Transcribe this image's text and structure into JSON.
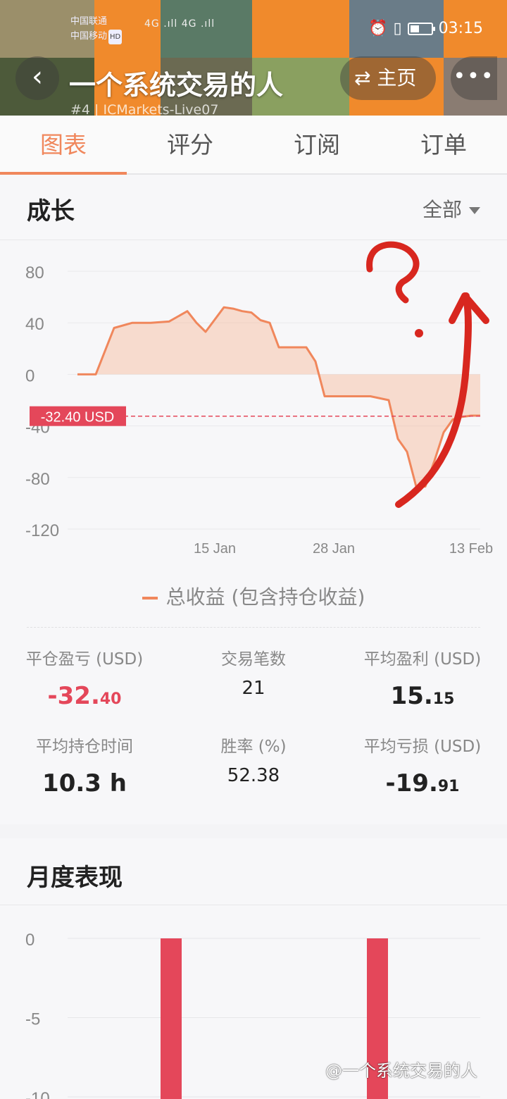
{
  "status_bar": {
    "carrier_1": "中国联通",
    "carrier_2": "中国移动",
    "hd_badge": "HD",
    "signal": "4G .ıll 4G .ıll",
    "time": "03:15"
  },
  "header": {
    "back_glyph": "‹",
    "title": "一个系统交易的人",
    "subtitle": "#4 | ICMarkets-Live07",
    "home_label": "⇄ 主页",
    "more_glyph": "•••"
  },
  "tabs": [
    {
      "label": "图表",
      "active": true
    },
    {
      "label": "评分"
    },
    {
      "label": "订阅"
    },
    {
      "label": "订单"
    }
  ],
  "growth": {
    "title": "成长",
    "filter": "全部",
    "current_label": "-32.40 USD",
    "legend": "总收益 (包含持仓收益)",
    "colors": {
      "line": "#f0875c",
      "fill": "#f7b79a",
      "marker": "#e4475a"
    },
    "stats": [
      {
        "label": "平仓盈亏 (USD)",
        "int": "-32.",
        "dec": "40",
        "negative": true
      },
      {
        "label": "交易笔数",
        "value": "21"
      },
      {
        "label": "平均盈利 (USD)",
        "int": "15.",
        "dec": "15"
      },
      {
        "label": "平均持仓时间",
        "value": "10.3 h"
      },
      {
        "label": "胜率 (%)",
        "value": "52.38"
      },
      {
        "label": "平均亏损 (USD)",
        "int": "-19.",
        "dec": "91"
      }
    ]
  },
  "chart_data": [
    {
      "type": "area",
      "y_ticks": [
        80,
        40,
        0,
        -40,
        -80,
        -120
      ],
      "ylim": [
        -120,
        80
      ],
      "x_tick_labels": [
        "15 Jan",
        "28 Jan",
        "13 Feb"
      ],
      "x_tick_index": [
        15,
        28,
        43
      ],
      "x_range": [
        0,
        44
      ],
      "reference_line": -32.4,
      "series": [
        {
          "x": [
            0,
            2,
            4,
            6,
            8,
            10,
            12,
            13,
            14,
            16,
            17,
            18,
            19,
            20,
            21,
            22,
            23,
            24,
            25,
            26,
            27,
            28,
            30,
            32,
            34,
            35,
            36,
            37,
            38,
            39,
            40,
            41,
            42,
            43,
            44
          ],
          "values": [
            0,
            0,
            36,
            40,
            40,
            41,
            49,
            40,
            33,
            52,
            51,
            49,
            48,
            42,
            40,
            21,
            21,
            21,
            21,
            10,
            -17,
            -17,
            -17,
            -17,
            -20,
            -50,
            -60,
            -87,
            -87,
            -67,
            -45,
            -35,
            -33,
            -32,
            -32
          ]
        }
      ]
    },
    {
      "type": "bar",
      "y_ticks": [
        0,
        -5,
        -10
      ],
      "ylim": [
        -12,
        0
      ],
      "series": [
        {
          "values": [
            -12,
            -12
          ]
        }
      ]
    }
  ],
  "watermark": "@一个系统交易的人"
}
